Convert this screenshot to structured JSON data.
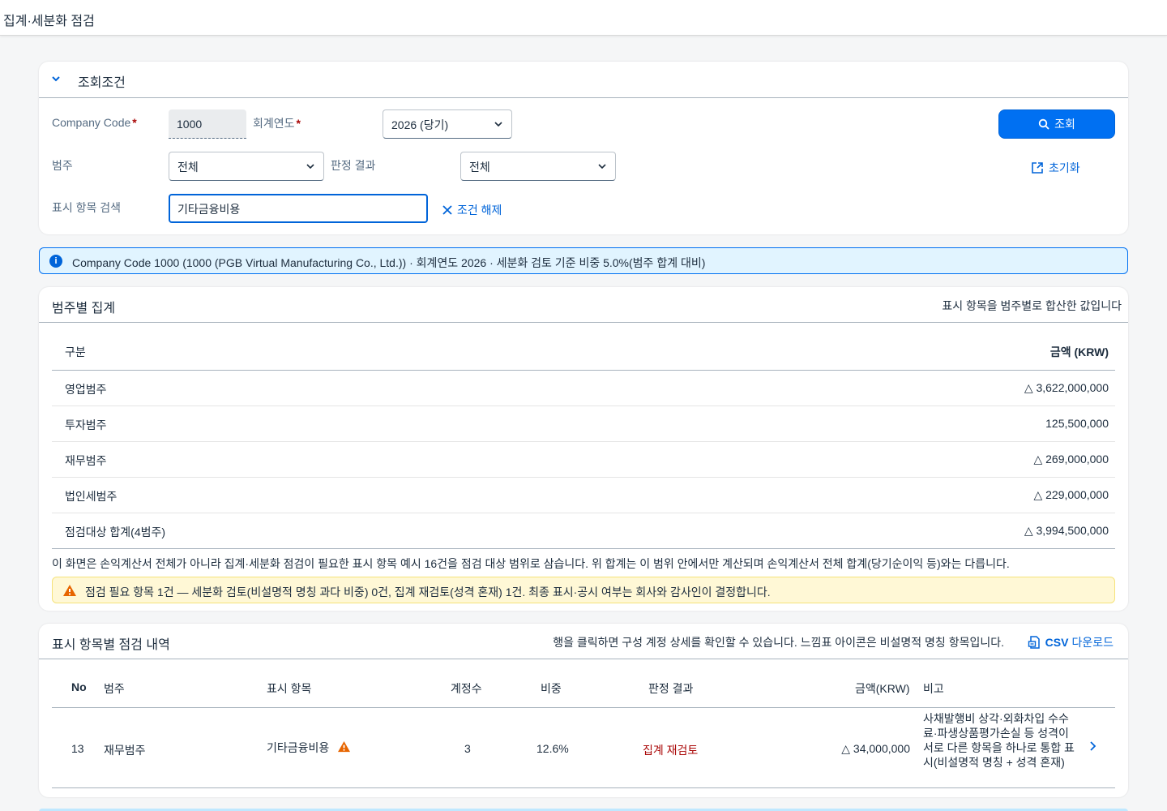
{
  "app": {
    "title": "집계·세분화 점검"
  },
  "filter": {
    "header": "조회조건",
    "company_code_label": "Company Code",
    "company_code_value": "1000",
    "fiscal_year_label": "회계연도",
    "fiscal_year_value": "2026 (당기)",
    "category_label": "범주",
    "category_value": "전체",
    "judgement_label": "판정 결과",
    "judgement_value": "전체",
    "search_label": "표시 항목 검색",
    "search_value": "기타금융비용",
    "clear_label": "조건 해제",
    "query_button": "조회",
    "reset_button": "초기화"
  },
  "info": {
    "text": "Company Code 1000 (1000 (PGB Virtual Manufacturing Co., Ltd.)) · 회계연도 2026 · 세분화 검토 기준 비중 5.0%(범주 합계 대비)"
  },
  "summary": {
    "title": "범주별 집계",
    "subtitle": "표시 항목을 범주별로 합산한 값입니다",
    "col_category": "구분",
    "col_amount": "금액 (KRW)",
    "rows": [
      {
        "name": "영업범주",
        "amount": "△ 3,622,000,000"
      },
      {
        "name": "투자범주",
        "amount": "125,500,000"
      },
      {
        "name": "재무범주",
        "amount": "△ 269,000,000"
      },
      {
        "name": "법인세범주",
        "amount": "△ 229,000,000"
      },
      {
        "name": "점검대상 합계(4범주)",
        "amount": "△ 3,994,500,000"
      }
    ],
    "note": "이 화면은 손익계산서 전체가 아니라 집계·세분화 점검이 필요한 표시 항목 예시 16건을 점검 대상 범위로 삼습니다. 위 합계는 이 범위 안에서만 계산되며 손익계산서 전체 합계(당기순이익 등)와는 다릅니다.",
    "warning": "점검 필요 항목 1건 — 세분화 검토(비설명적 명칭 과다 비중) 0건, 집계 재검토(성격 혼재) 1건. 최종 표시·공시 여부는 회사와 감사인이 결정합니다."
  },
  "detail": {
    "title": "표시 항목별 점검 내역",
    "subtitle": "행을 클릭하면 구성 계정 상세를 확인할 수 있습니다. 느낌표 아이콘은 비설명적 명칭 항목입니다.",
    "csv_prefix": "CSV",
    "csv_label": "다운로드",
    "columns": {
      "no": "No",
      "category": "범주",
      "item": "표시 항목",
      "accounts": "계정수",
      "ratio": "비중",
      "judgement": "판정 결과",
      "amount": "금액(KRW)",
      "note": "비고"
    },
    "rows": [
      {
        "no": "13",
        "category": "재무범주",
        "item": "기타금융비용",
        "accounts": "3",
        "ratio": "12.6%",
        "judgement": "집계 재검토",
        "amount": "△ 34,000,000",
        "note": "사채발행비 상각·외화차입 수수료·파생상품평가손실 등 성격이 서로 다른 항목을 하나로 통합 표시(비설명적 명칭 + 성격 혼재)"
      }
    ]
  },
  "colors": {
    "accent": "#0070f2",
    "info_bg": "#e1f4ff",
    "warning_bg": "#fff8d6",
    "negative": "#aa0808"
  }
}
